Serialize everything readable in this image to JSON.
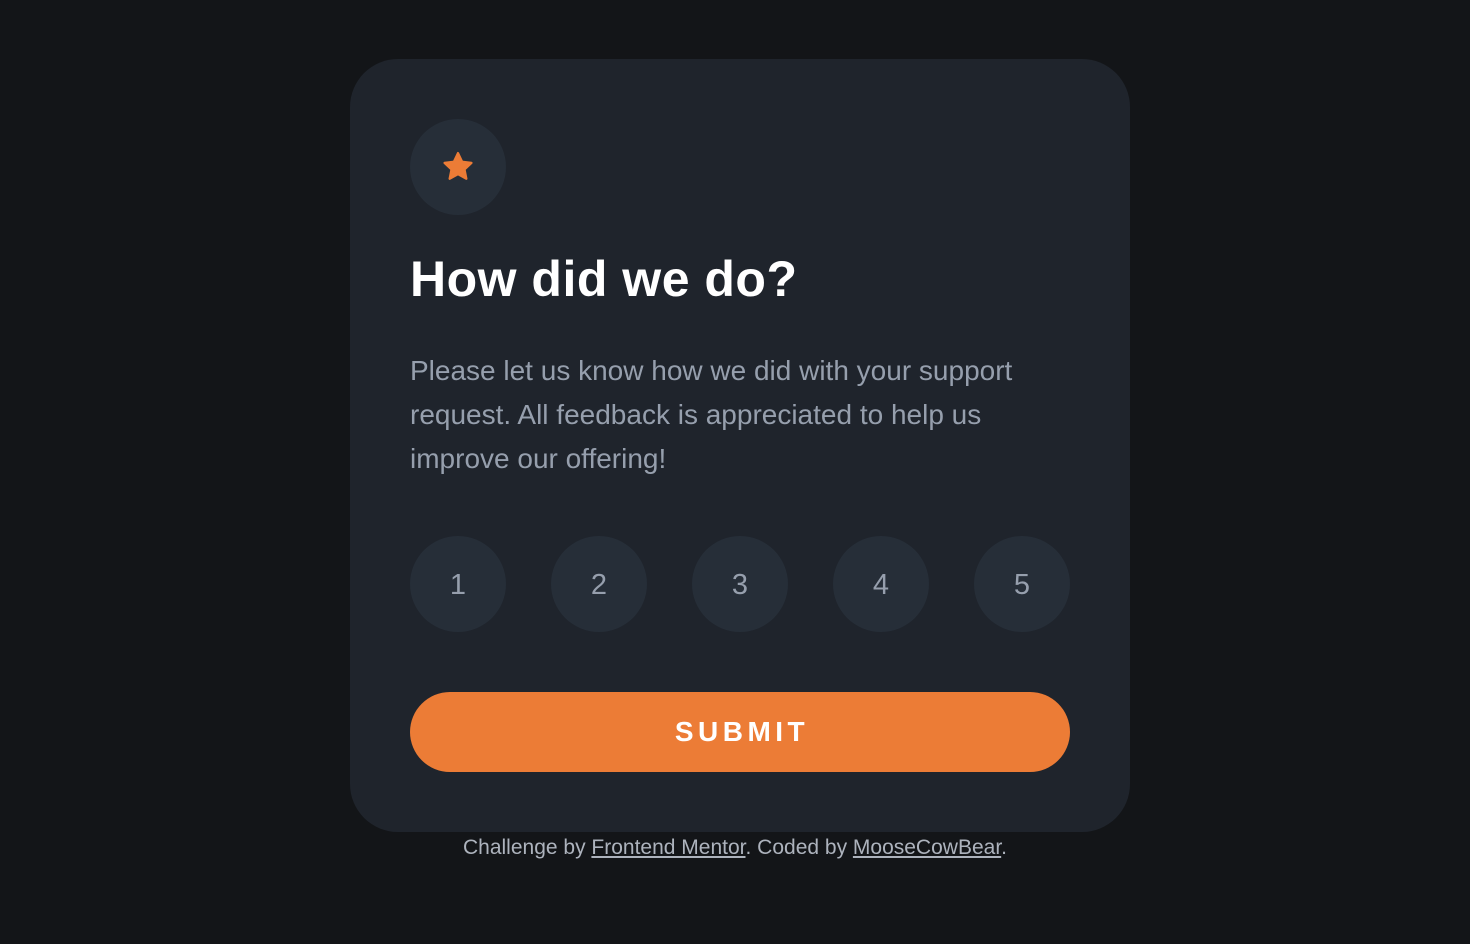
{
  "card": {
    "icon": "star-icon",
    "title": "How did we do?",
    "description": "Please let us know how we did with your support request. All feedback is appreciated to help us improve our offering!",
    "ratings": [
      "1",
      "2",
      "3",
      "4",
      "5"
    ],
    "submit_label": "SUBMIT"
  },
  "attribution": {
    "prefix": "Challenge by ",
    "challenge_link": "Frontend Mentor",
    "middle": ". Coded by ",
    "author_link": "MooseCowBear",
    "suffix": "."
  },
  "colors": {
    "background": "#131518",
    "card": "#1f242c",
    "circle": "#262e38",
    "accent": "#ec7c36",
    "muted_text": "#969fad",
    "title_text": "#ffffff"
  }
}
